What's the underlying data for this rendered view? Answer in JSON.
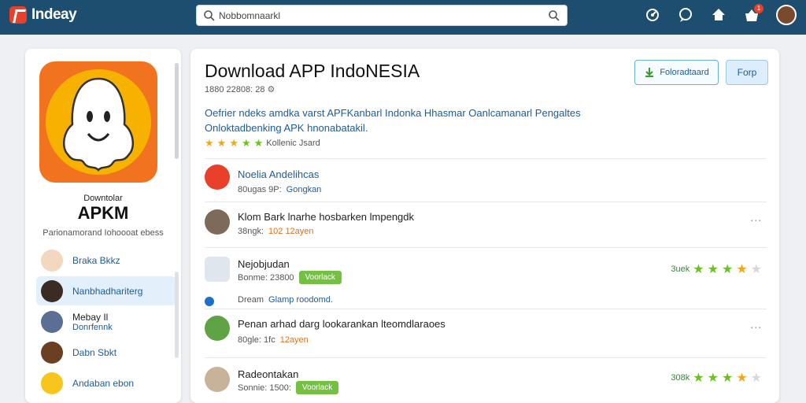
{
  "brand": {
    "name": "Indeay",
    "accent": "#e8402a",
    "bar_color": "#1d4e70"
  },
  "search": {
    "value": "Nobbomnaarkl"
  },
  "topbar": {
    "notification_count": "1"
  },
  "sidebar": {
    "subtitle": "Downtolar",
    "title": "APKM",
    "description": "Parionamorand Iohoooat ebess",
    "items": [
      {
        "label": "Braka Bkkz",
        "avatar": "avatar-light"
      },
      {
        "label": "Nanbhadhariterg",
        "avatar": "avatar-dark",
        "active": true
      },
      {
        "label": "Mebay Il",
        "sub": "Donrfennk",
        "avatar": "avatar-blue"
      },
      {
        "label": "Dabn Sbkt",
        "avatar": "avatar-brown"
      },
      {
        "label": "Andaban ebon",
        "avatar": "avatar-emoji"
      }
    ]
  },
  "main": {
    "title": "Download APP IndoNESIA",
    "meta": "1880 22808: 28",
    "buttons": {
      "primary": "Foloradtaard",
      "secondary": "Forp"
    },
    "description_line1": "Oefrier ndeks amdka varst APFKanbarl Indonka Hhasmar Oanlcamanarl Pengaltes",
    "description_line2": "Onloktadbenking APK hnonabatakil.",
    "rating_label": "Kollenic Jsard",
    "rows": [
      {
        "title": "Noelia Andelihcas",
        "meta": "80ugas  9P:",
        "meta_link": "Gongkan",
        "avatar": "red-logo",
        "title_blue": true
      },
      {
        "title": "Klom Bark lnarhe hosbarken lmpengdk",
        "meta": "38ngk:",
        "tag": "102  12ayen",
        "avatar": "person-1",
        "more": "..."
      },
      {
        "title": "Nejobjudan",
        "meta": "Bonme: 23800",
        "pill": "Voorlack",
        "avatar": "phone",
        "rating": "3uek"
      },
      {
        "title": "Dream",
        "meta_link": "Glamp roodomd.",
        "avatar": "dot",
        "small": true
      },
      {
        "title": "Penan arhad darg lookarankan lteomdlaraoes",
        "meta": "80gle: 1fc",
        "tag": "12ayen",
        "avatar": "person-2",
        "more": "..."
      },
      {
        "title": "Radeontakan",
        "meta": "Sonnie: 1500:",
        "pill": "Voorlack",
        "avatar": "person-3",
        "rating": "308k"
      }
    ]
  }
}
